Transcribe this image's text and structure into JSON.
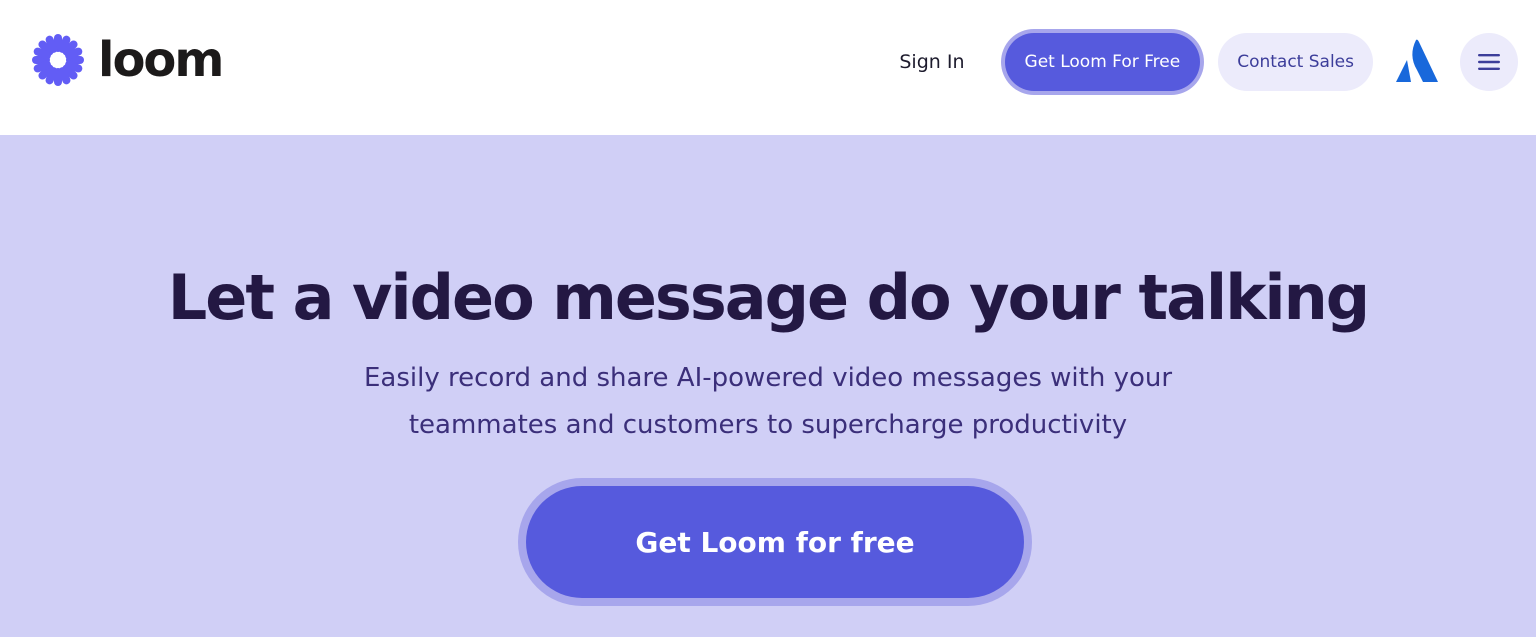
{
  "brand": {
    "name": "loom",
    "icon": "loom-starburst-icon",
    "color": "#625DF5"
  },
  "nav": {
    "sign_in": "Sign In",
    "get_free": "Get Loom For Free",
    "contact_sales": "Contact Sales",
    "atlassian_icon": "atlassian-icon",
    "menu_icon": "hamburger-menu-icon"
  },
  "hero": {
    "headline": "Let a video message do your talking",
    "subhead_line1": "Easily record and share AI-powered video messages with your",
    "subhead_line2": "teammates and customers to supercharge productivity",
    "cta": "Get Loom for free"
  },
  "colors": {
    "accent": "#565ADD",
    "hero_bg": "#D0CFF6",
    "headline": "#231843",
    "atlassian": "#1868DB"
  }
}
